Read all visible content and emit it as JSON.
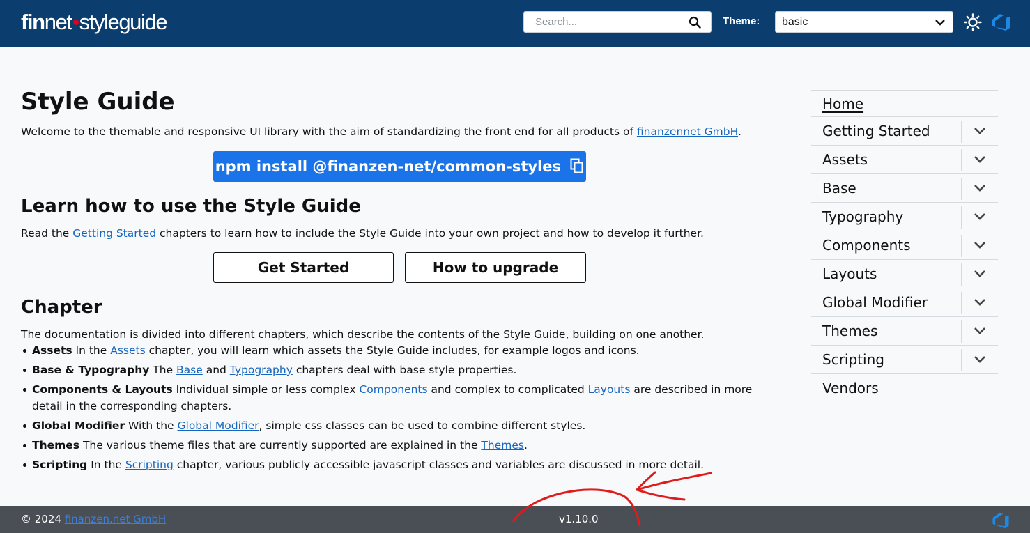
{
  "header": {
    "logo_fin": "fin",
    "logo_net": "net",
    "logo_suffix": "styleguide",
    "search_placeholder": "Search...",
    "theme_label": "Theme:",
    "theme_value": "basic",
    "colors": {
      "header_bg": "#0b3d6e",
      "logo_dot": "#e2001a"
    },
    "icons": [
      "search-icon",
      "chevron-down-icon",
      "sun-icon",
      "azure-devops-icon"
    ]
  },
  "main": {
    "title": "Style Guide",
    "intro_text": "Welcome to the themable and responsive UI library with the aim of standardizing the front end for all products of ",
    "intro_link": "finanzennet GmbH",
    "intro_end": ".",
    "npm_command": "npm install @finanzen-net/common-styles",
    "learn_heading": "Learn how to use the Style Guide",
    "learn_text_pre": "Read the ",
    "learn_link": "Getting Started",
    "learn_text_post": " chapters to learn how to include the Style Guide into your own project and how to develop it further.",
    "btn_get_started": "Get Started",
    "btn_upgrade": "How to upgrade",
    "chapter_heading": "Chapter",
    "chapter_text": "The documentation is divided into different chapters, which describe the contents of the Style Guide, building on one another.",
    "chapters": [
      {
        "bold": "Assets",
        "t1": " In the ",
        "link1": "Assets",
        "t2": " chapter, you will learn which assets the Style Guide includes, for example logos and icons."
      },
      {
        "bold": "Base & Typography",
        "t1": " The ",
        "link1": "Base",
        "t2": " and ",
        "link2": "Typography",
        "t3": " chapters deal with base style properties."
      },
      {
        "bold": "Components & Layouts",
        "t1": " Individual simple or less complex ",
        "link1": "Components",
        "t2": " and complex to complicated ",
        "link2": "Layouts",
        "t3": " are described in more detail in the corresponding chapters."
      },
      {
        "bold": "Global Modifier",
        "t1": " With the ",
        "link1": "Global Modifier",
        "t2": ", simple css classes can be used to combine different styles."
      },
      {
        "bold": "Themes",
        "t1": " The various theme files that are currently supported are explained in the ",
        "link1": "Themes",
        "t2": "."
      },
      {
        "bold": "Scripting",
        "t1": " In the ",
        "link1": "Scripting",
        "t2": " chapter, various publicly accessible javascript classes and variables are discussed in more detail."
      }
    ],
    "colors": {
      "primary_button": "#1a73e8",
      "link": "#1565c0"
    }
  },
  "sidebar": {
    "items": [
      {
        "label": "Home",
        "expandable": false
      },
      {
        "label": "Getting Started",
        "expandable": true
      },
      {
        "label": "Assets",
        "expandable": true
      },
      {
        "label": "Base",
        "expandable": true
      },
      {
        "label": "Typography",
        "expandable": true
      },
      {
        "label": "Components",
        "expandable": true
      },
      {
        "label": "Layouts",
        "expandable": true
      },
      {
        "label": "Global Modifier",
        "expandable": true
      },
      {
        "label": "Themes",
        "expandable": true
      },
      {
        "label": "Scripting",
        "expandable": true
      },
      {
        "label": "Vendors",
        "expandable": false
      }
    ]
  },
  "footer": {
    "copyright": "© 2024 ",
    "company_link": "finanzen.net GmbH",
    "version": "v1.10.0",
    "colors": {
      "footer_bg": "#4a4f55"
    }
  },
  "annotation": {
    "color": "#e01b1b"
  }
}
